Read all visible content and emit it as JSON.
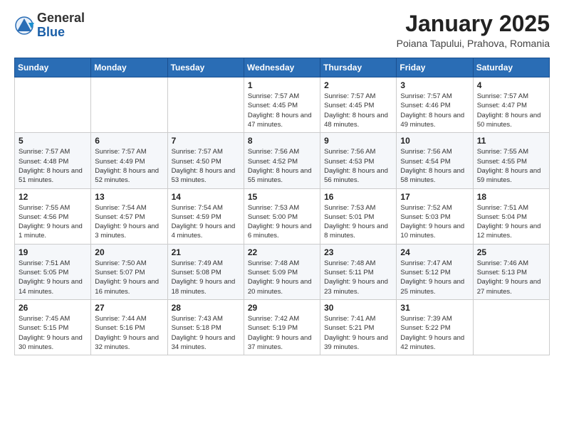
{
  "header": {
    "logo_general": "General",
    "logo_blue": "Blue",
    "month_title": "January 2025",
    "location": "Poiana Tapului, Prahova, Romania"
  },
  "weekdays": [
    "Sunday",
    "Monday",
    "Tuesday",
    "Wednesday",
    "Thursday",
    "Friday",
    "Saturday"
  ],
  "weeks": [
    [
      {
        "day": "",
        "info": ""
      },
      {
        "day": "",
        "info": ""
      },
      {
        "day": "",
        "info": ""
      },
      {
        "day": "1",
        "info": "Sunrise: 7:57 AM\nSunset: 4:45 PM\nDaylight: 8 hours and 47 minutes."
      },
      {
        "day": "2",
        "info": "Sunrise: 7:57 AM\nSunset: 4:45 PM\nDaylight: 8 hours and 48 minutes."
      },
      {
        "day": "3",
        "info": "Sunrise: 7:57 AM\nSunset: 4:46 PM\nDaylight: 8 hours and 49 minutes."
      },
      {
        "day": "4",
        "info": "Sunrise: 7:57 AM\nSunset: 4:47 PM\nDaylight: 8 hours and 50 minutes."
      }
    ],
    [
      {
        "day": "5",
        "info": "Sunrise: 7:57 AM\nSunset: 4:48 PM\nDaylight: 8 hours and 51 minutes."
      },
      {
        "day": "6",
        "info": "Sunrise: 7:57 AM\nSunset: 4:49 PM\nDaylight: 8 hours and 52 minutes."
      },
      {
        "day": "7",
        "info": "Sunrise: 7:57 AM\nSunset: 4:50 PM\nDaylight: 8 hours and 53 minutes."
      },
      {
        "day": "8",
        "info": "Sunrise: 7:56 AM\nSunset: 4:52 PM\nDaylight: 8 hours and 55 minutes."
      },
      {
        "day": "9",
        "info": "Sunrise: 7:56 AM\nSunset: 4:53 PM\nDaylight: 8 hours and 56 minutes."
      },
      {
        "day": "10",
        "info": "Sunrise: 7:56 AM\nSunset: 4:54 PM\nDaylight: 8 hours and 58 minutes."
      },
      {
        "day": "11",
        "info": "Sunrise: 7:55 AM\nSunset: 4:55 PM\nDaylight: 8 hours and 59 minutes."
      }
    ],
    [
      {
        "day": "12",
        "info": "Sunrise: 7:55 AM\nSunset: 4:56 PM\nDaylight: 9 hours and 1 minute."
      },
      {
        "day": "13",
        "info": "Sunrise: 7:54 AM\nSunset: 4:57 PM\nDaylight: 9 hours and 3 minutes."
      },
      {
        "day": "14",
        "info": "Sunrise: 7:54 AM\nSunset: 4:59 PM\nDaylight: 9 hours and 4 minutes."
      },
      {
        "day": "15",
        "info": "Sunrise: 7:53 AM\nSunset: 5:00 PM\nDaylight: 9 hours and 6 minutes."
      },
      {
        "day": "16",
        "info": "Sunrise: 7:53 AM\nSunset: 5:01 PM\nDaylight: 9 hours and 8 minutes."
      },
      {
        "day": "17",
        "info": "Sunrise: 7:52 AM\nSunset: 5:03 PM\nDaylight: 9 hours and 10 minutes."
      },
      {
        "day": "18",
        "info": "Sunrise: 7:51 AM\nSunset: 5:04 PM\nDaylight: 9 hours and 12 minutes."
      }
    ],
    [
      {
        "day": "19",
        "info": "Sunrise: 7:51 AM\nSunset: 5:05 PM\nDaylight: 9 hours and 14 minutes."
      },
      {
        "day": "20",
        "info": "Sunrise: 7:50 AM\nSunset: 5:07 PM\nDaylight: 9 hours and 16 minutes."
      },
      {
        "day": "21",
        "info": "Sunrise: 7:49 AM\nSunset: 5:08 PM\nDaylight: 9 hours and 18 minutes."
      },
      {
        "day": "22",
        "info": "Sunrise: 7:48 AM\nSunset: 5:09 PM\nDaylight: 9 hours and 20 minutes."
      },
      {
        "day": "23",
        "info": "Sunrise: 7:48 AM\nSunset: 5:11 PM\nDaylight: 9 hours and 23 minutes."
      },
      {
        "day": "24",
        "info": "Sunrise: 7:47 AM\nSunset: 5:12 PM\nDaylight: 9 hours and 25 minutes."
      },
      {
        "day": "25",
        "info": "Sunrise: 7:46 AM\nSunset: 5:13 PM\nDaylight: 9 hours and 27 minutes."
      }
    ],
    [
      {
        "day": "26",
        "info": "Sunrise: 7:45 AM\nSunset: 5:15 PM\nDaylight: 9 hours and 30 minutes."
      },
      {
        "day": "27",
        "info": "Sunrise: 7:44 AM\nSunset: 5:16 PM\nDaylight: 9 hours and 32 minutes."
      },
      {
        "day": "28",
        "info": "Sunrise: 7:43 AM\nSunset: 5:18 PM\nDaylight: 9 hours and 34 minutes."
      },
      {
        "day": "29",
        "info": "Sunrise: 7:42 AM\nSunset: 5:19 PM\nDaylight: 9 hours and 37 minutes."
      },
      {
        "day": "30",
        "info": "Sunrise: 7:41 AM\nSunset: 5:21 PM\nDaylight: 9 hours and 39 minutes."
      },
      {
        "day": "31",
        "info": "Sunrise: 7:39 AM\nSunset: 5:22 PM\nDaylight: 9 hours and 42 minutes."
      },
      {
        "day": "",
        "info": ""
      }
    ]
  ]
}
